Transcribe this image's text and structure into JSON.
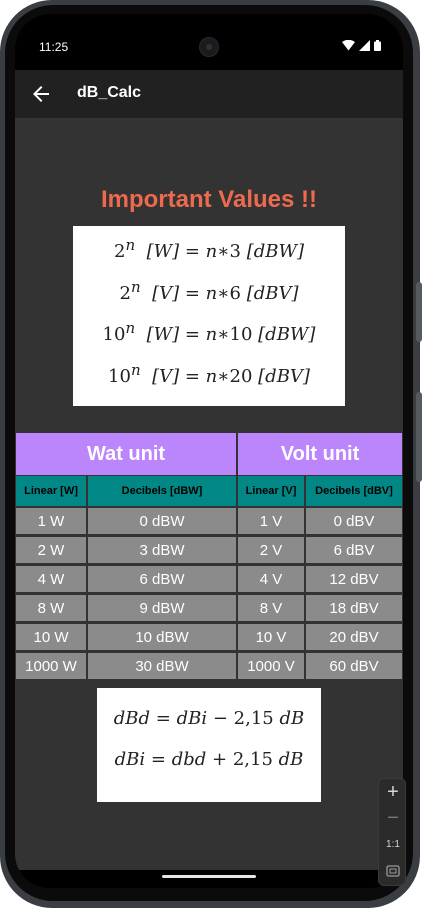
{
  "status_bar": {
    "time": "11:25"
  },
  "app_bar": {
    "title": "dB_Calc"
  },
  "heading": "Important Values !!",
  "formulas_top": [
    {
      "base": "2",
      "exp": "n",
      "unit": "[W]",
      "mult": "3",
      "result_unit": "[dBW]"
    },
    {
      "base": "2",
      "exp": "n",
      "unit": "[V]",
      "mult": "6",
      "result_unit": "[dBV]"
    },
    {
      "base": "10",
      "exp": "n",
      "unit": "[W]",
      "mult": "10",
      "result_unit": "[dBW]"
    },
    {
      "base": "10",
      "exp": "n",
      "unit": "[V]",
      "mult": "20",
      "result_unit": "[dBV]"
    }
  ],
  "table": {
    "groups": [
      "Wat unit",
      "Volt unit"
    ],
    "columns": [
      "Linear [W]",
      "Decibels [dBW]",
      "Linear [V]",
      "Decibels [dBV]"
    ],
    "rows": [
      [
        "1 W",
        "0 dBW",
        "1 V",
        "0 dBV"
      ],
      [
        "2 W",
        "3 dBW",
        "2 V",
        "6 dBV"
      ],
      [
        "4 W",
        "6 dBW",
        "4 V",
        "12 dBV"
      ],
      [
        "8 W",
        "9 dBW",
        "8 V",
        "18 dBV"
      ],
      [
        "10 W",
        "10 dBW",
        "10 V",
        "20 dBV"
      ],
      [
        "1000 W",
        "30 dBW",
        "1000 V",
        "60 dBV"
      ]
    ]
  },
  "formulas_bottom": [
    {
      "lhs": "dBd",
      "op": "−",
      "mid": "dBi",
      "num": "2,15",
      "unit": "dB"
    },
    {
      "lhs": "dBi",
      "op": "+",
      "mid": "dbd",
      "num": "2,15",
      "unit": "dB"
    }
  ],
  "zoom_controls": {
    "zoom_in": "+",
    "zoom_out": "−",
    "reset": "1:1"
  },
  "colors": {
    "accent_heading": "#ee6a4f",
    "header_purple": "#bb86fc",
    "subheader_teal": "#018786",
    "cell_gray": "#8b8b8b",
    "background": "#333333",
    "appbar": "#212121"
  }
}
